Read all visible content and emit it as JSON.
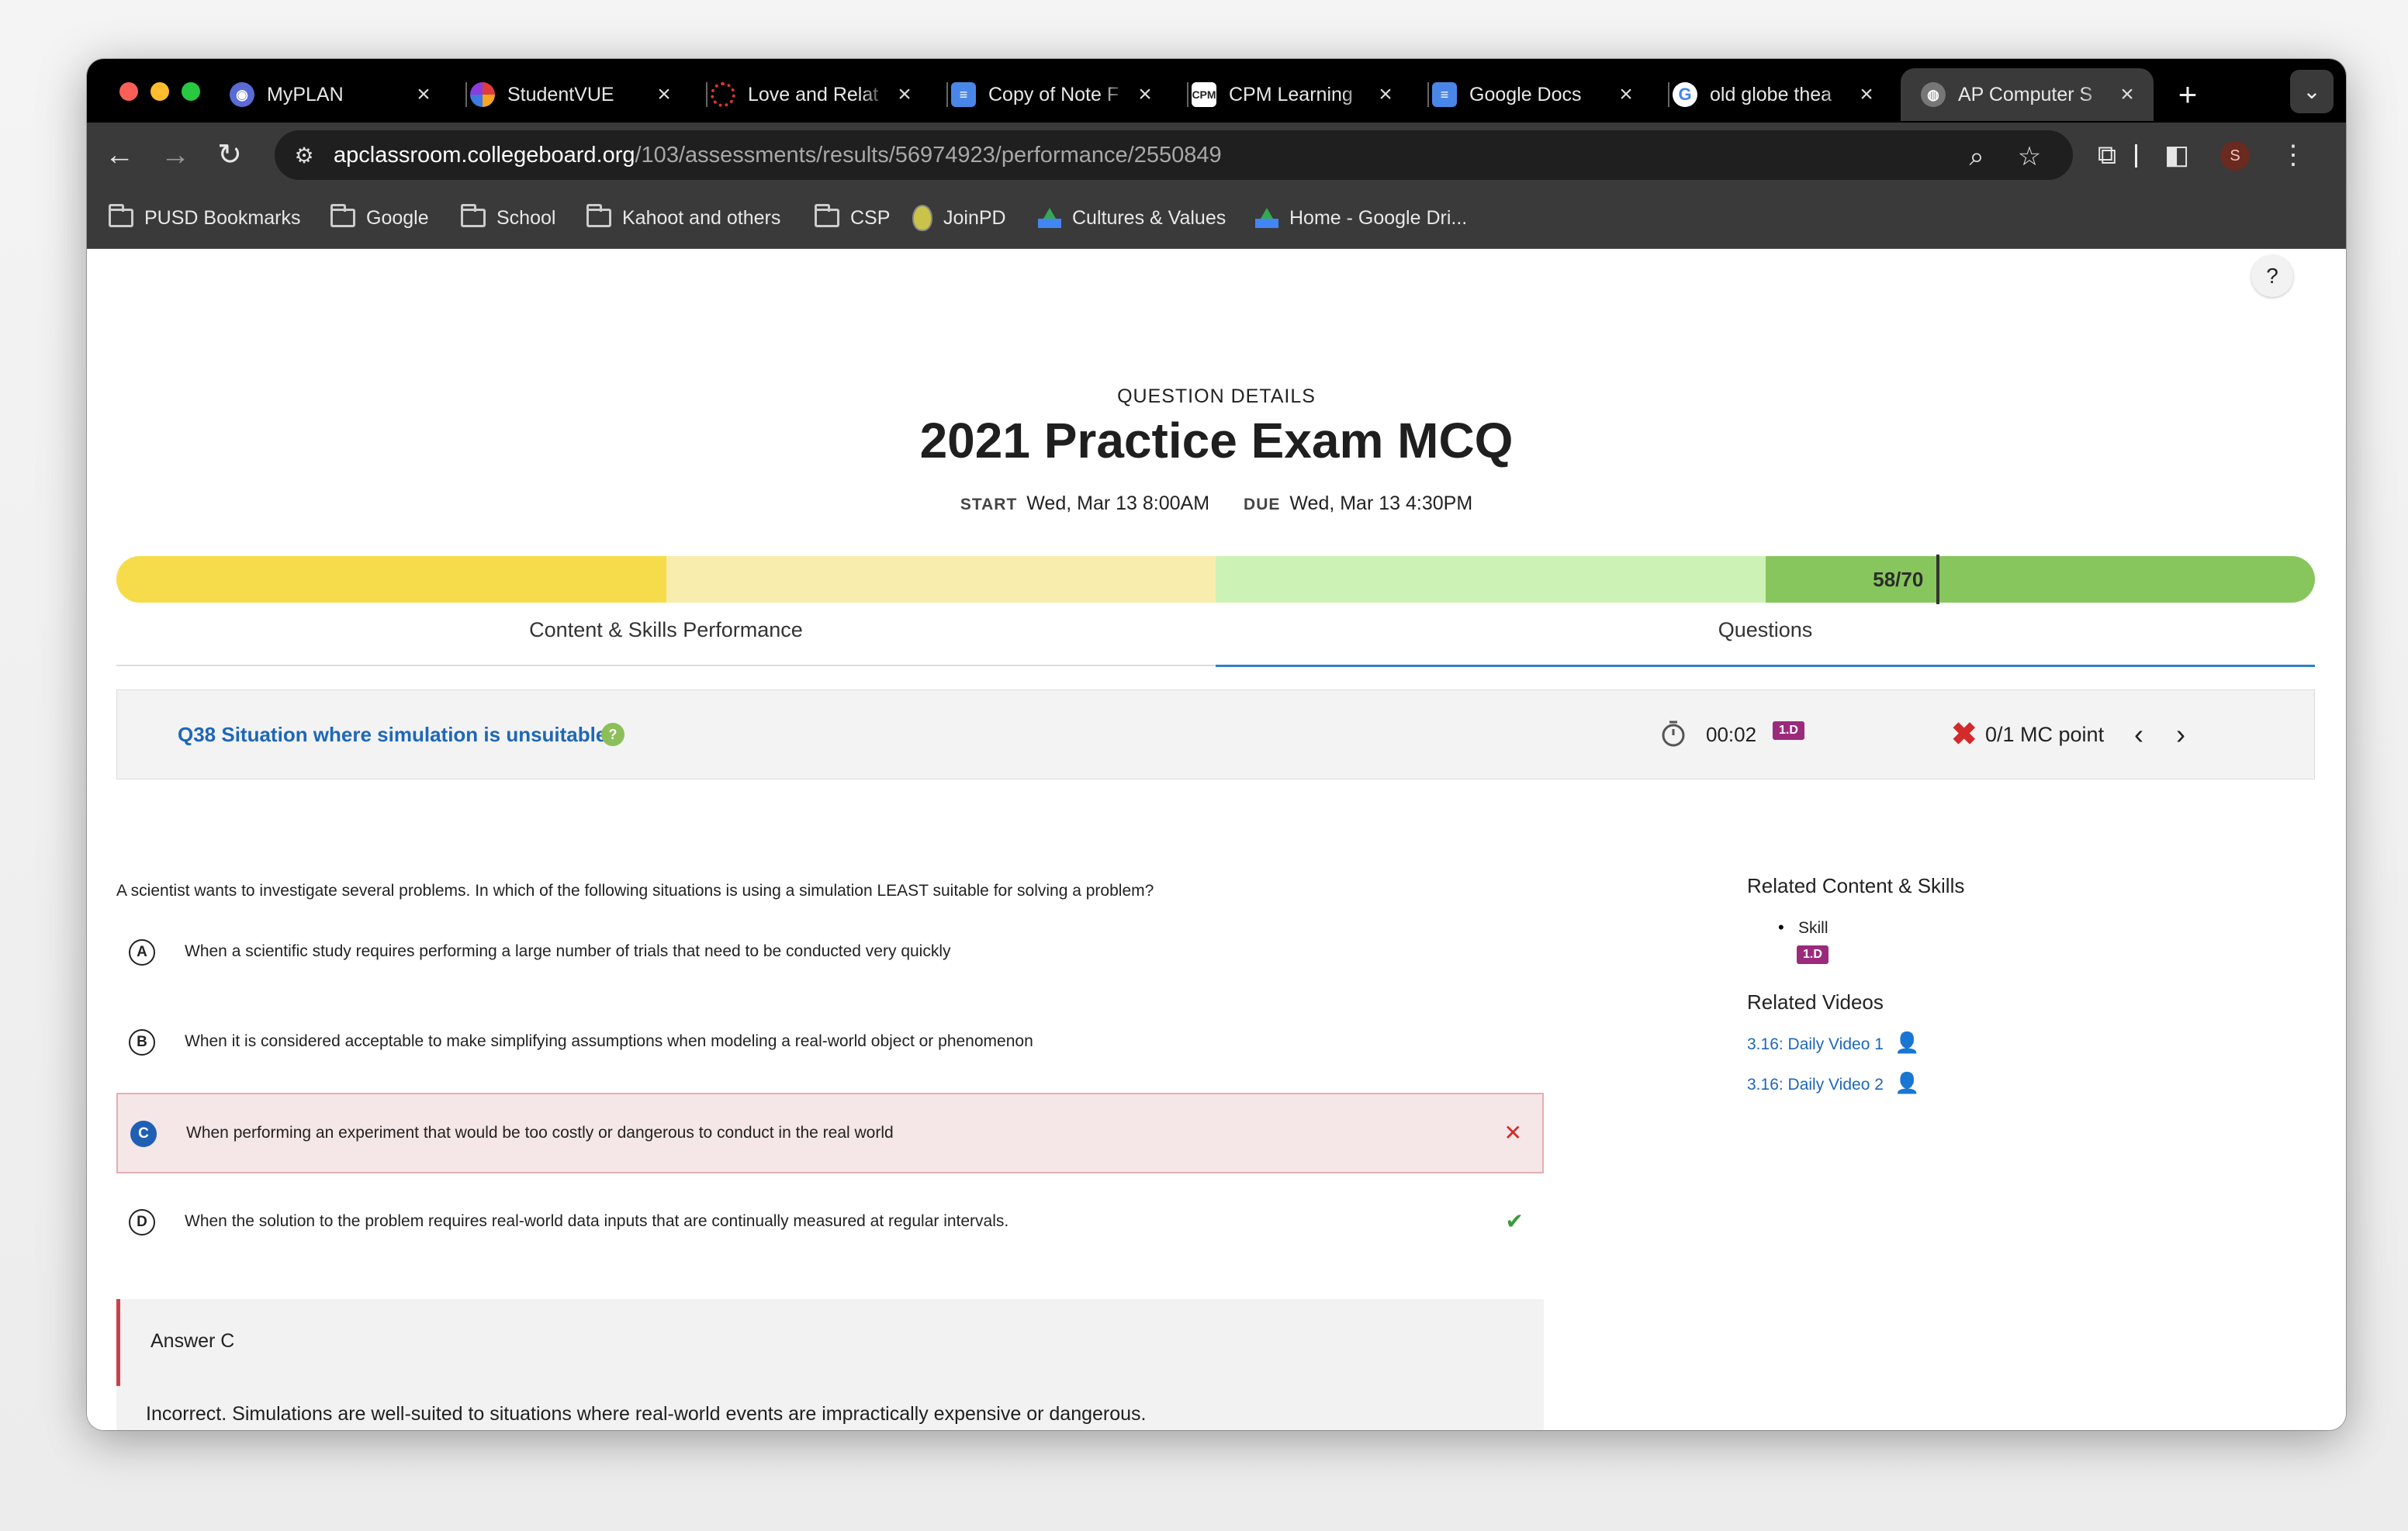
{
  "browser": {
    "tabs": [
      {
        "title": "MyPLAN",
        "icon": "myplan-icon",
        "color": "#5a6bd6"
      },
      {
        "title": "StudentVUE",
        "icon": "studentvue-icon",
        "color": "#e03c3c"
      },
      {
        "title": "Love and Relat",
        "icon": "canvas-icon",
        "color": "#e0352b"
      },
      {
        "title": "Copy of Note F",
        "icon": "google-docs-icon",
        "color": "#4a86e8"
      },
      {
        "title": "CPM Learning",
        "icon": "cpm-icon",
        "color": "#222222"
      },
      {
        "title": "Google Docs",
        "icon": "google-docs-icon",
        "color": "#4a86e8"
      },
      {
        "title": "old globe thea",
        "icon": "google-icon",
        "color": "#ffffff"
      },
      {
        "title": "AP Computer S",
        "icon": "globe-icon",
        "color": "#777777",
        "active": true
      }
    ],
    "url_host": "apclassroom.collegeboard.org",
    "url_path": "/103/assessments/results/56974923/performance/2550849",
    "profile_initial": "S",
    "bookmarks": [
      {
        "label": "PUSD Bookmarks",
        "icon": "bookmarks-folder-icon"
      },
      {
        "label": "Google",
        "icon": "folder-icon"
      },
      {
        "label": "School",
        "icon": "folder-icon"
      },
      {
        "label": "Kahoot and others",
        "icon": "folder-icon"
      },
      {
        "label": "CSP",
        "icon": "folder-icon"
      },
      {
        "label": "JoinPD",
        "icon": "pear-icon"
      },
      {
        "label": "Cultures & Values",
        "icon": "google-drive-icon"
      },
      {
        "label": "Home - Google Dri...",
        "icon": "google-drive-icon"
      }
    ]
  },
  "page": {
    "help_label": "?",
    "overline": "QUESTION DETAILS",
    "title": "2021 Practice Exam MCQ",
    "start_label": "START",
    "start_value": "Wed, Mar 13 8:00AM",
    "due_label": "DUE",
    "due_value": "Wed, Mar 13 4:30PM",
    "score_text": "58/70",
    "score_fraction": 0.8286,
    "bar_colors": [
      "#f6dc4a",
      "#f9edae",
      "#cdf2b6",
      "#87c65c"
    ],
    "tabs": [
      {
        "label": "Content & Skills Performance",
        "active": false
      },
      {
        "label": "Questions",
        "active": true
      }
    ]
  },
  "question": {
    "header_title": "Q38 Situation where simulation is unsuitable",
    "hint_icon": "?",
    "time": "00:02",
    "skill_badge": "1.D",
    "result_icon": "✖",
    "points": "0/1 MC point",
    "prev_icon": "‹",
    "next_icon": "›",
    "prompt": "A scientist wants to investigate several problems. In which of the following situations is using a simulation LEAST suitable for solving a problem?",
    "options": [
      {
        "letter": "A",
        "text": "When a scientific study requires performing a large number of trials that need to be conducted very quickly",
        "selected": false,
        "mark": ""
      },
      {
        "letter": "B",
        "text": "When it is considered acceptable to make simplifying assumptions when modeling a real-world object or phenomenon",
        "selected": false,
        "mark": ""
      },
      {
        "letter": "C",
        "text": "When performing an experiment that would be too costly or dangerous to conduct in the real world",
        "selected": true,
        "mark": "✕"
      },
      {
        "letter": "D",
        "text": "When the solution to the problem requires real-world data inputs that are continually measured at regular intervals.",
        "selected": false,
        "mark": "✔"
      }
    ],
    "answer_label": "Answer C",
    "answer_explanation": "Incorrect. Simulations are well-suited to situations where real-world events are impractically expensive or dangerous."
  },
  "sidebar": {
    "related_heading": "Related Content & Skills",
    "skill_label": "Skill",
    "skill_badge": "1.D",
    "videos_heading": "Related Videos",
    "videos": [
      {
        "label": "3.16: Daily Video 1",
        "icon": "person-check-icon"
      },
      {
        "label": "3.16: Daily Video 2",
        "icon": "person-check-icon"
      }
    ]
  }
}
